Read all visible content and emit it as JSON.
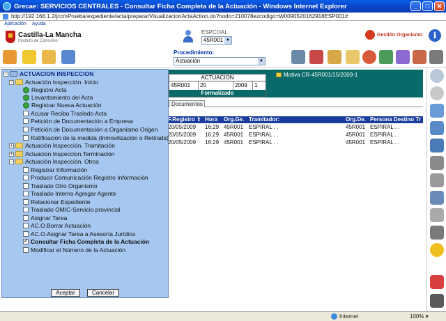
{
  "window": {
    "title": "Grecae: SERVICIOS CENTRALES - Consultar Ficha Completa de la Actuación - Windows Internet Explorer",
    "url": "http://192.168.1.2/jccmPrueba/expediente/acta/prepararVisualizacionActaAction.do?nodo=210078ezcodigo=W0090520162918ESP001#"
  },
  "app_menu": [
    "Aplicación",
    "Ayuda"
  ],
  "header": {
    "brand": "Castilla-La Mancha",
    "sub": "Instituto de Consumo",
    "espcoal_label": "ESPCOAL",
    "espcoal_value": "45R001",
    "gestion": "Gestión Organismo"
  },
  "toolbar": {
    "procedimiento_label": "Procedimiento:",
    "procedimiento_value": "Actuación"
  },
  "actuacion": {
    "title": "ACTUACION",
    "fields": [
      "45R001",
      "20",
      "2009",
      "1"
    ],
    "state": "Formalizado",
    "motiva": "Motiva CR-45R001/15/2009-1"
  },
  "tabs": [
    "Documentos"
  ],
  "table": {
    "headers": [
      "F.Registro",
      "Hora",
      "Org.Ge.",
      "Tramitador:",
      "Org.De.",
      "Persona Destino Tr"
    ],
    "rows": [
      [
        "20/05/2009",
        "16:29",
        "45R001",
        "ESPIRAL . .",
        "45R001",
        "ESPIRAL . ."
      ],
      [
        "20/05/2009",
        "16:29",
        "45R001",
        "ESPIRAL . .",
        "45R001",
        "ESPIRAL . ."
      ],
      [
        "20/05/2009",
        "16:29",
        "45R001",
        "ESPIRAL . .",
        "45R001",
        "ESPIRAL . ."
      ]
    ]
  },
  "tree": {
    "root": "ACTUACION INSPECCION",
    "nodes": [
      {
        "label": "Actuación Inspección. Inicio",
        "kind": "folder",
        "expander": "-"
      },
      {
        "label": "Registro Acta",
        "kind": "done"
      },
      {
        "label": "Levantamiento del Acta",
        "kind": "done"
      },
      {
        "label": "Registrar Nueva Actuación",
        "kind": "done"
      },
      {
        "label": "Acusar Recibo Traslado Acta",
        "kind": "box"
      },
      {
        "label": "Petición de Documentación a Empresa",
        "kind": "box"
      },
      {
        "label": "Petición de Documentación a Organismo Origen",
        "kind": "box"
      },
      {
        "label": "Ratificación de la medida (Inmovilización o Retirada)",
        "kind": "box"
      },
      {
        "label": "Actuación Inspección. Tramitación",
        "kind": "folder",
        "expander": "+"
      },
      {
        "label": "Actuacion Inspeccion.Terminacion",
        "kind": "folder",
        "expander": "+"
      },
      {
        "label": "Actuación Inspección. Otros",
        "kind": "folder",
        "expander": "-"
      },
      {
        "label": "Registrar Información",
        "kind": "box"
      },
      {
        "label": "Producir Comunicación Registro Información",
        "kind": "box"
      },
      {
        "label": "Traslado Otro Organismo",
        "kind": "box"
      },
      {
        "label": "Traslado Interno Agregar Agente",
        "kind": "box"
      },
      {
        "label": "Relacionar Expediente",
        "kind": "box"
      },
      {
        "label": "Traslado OMIC-Servicio provincial",
        "kind": "box"
      },
      {
        "label": "Asignar Tarea",
        "kind": "box"
      },
      {
        "label": "AC.O.Borrar Actuación",
        "kind": "box"
      },
      {
        "label": "AC.O.Asignar Tarea a Asesoría Jurídica",
        "kind": "box"
      },
      {
        "label": "Consultar Ficha Completa de la Actuación",
        "kind": "checked"
      },
      {
        "label": "Modificar el Número de la Actuación",
        "kind": "box"
      }
    ],
    "accept_label": "Aceptar",
    "cancel_label": "Cancelar"
  },
  "status": {
    "zone": "Internet",
    "zoom": "100%"
  }
}
